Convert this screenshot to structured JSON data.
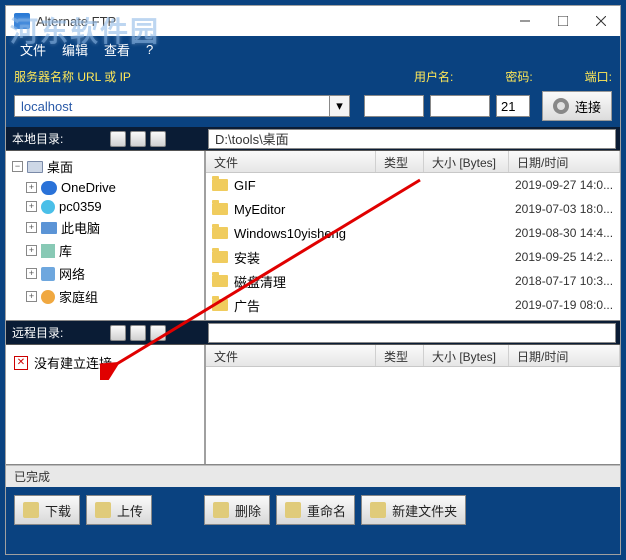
{
  "watermark": "河东软件园",
  "window": {
    "title": "Alternate FTP"
  },
  "menu": {
    "items": [
      "文件",
      "编辑",
      "查看",
      "?"
    ]
  },
  "conn": {
    "server_label": "服务器名称 URL 或 IP",
    "server_value": "localhost",
    "user_label": "用户名:",
    "pass_label": "密码:",
    "port_label": "端口:",
    "port_value": "21",
    "connect_label": "连接"
  },
  "local": {
    "label": "本地目录:",
    "path": "D:\\tools\\桌面",
    "tree": {
      "root": "桌面",
      "items": [
        "OneDrive",
        "pc0359",
        "此电脑",
        "库",
        "网络",
        "家庭组"
      ]
    },
    "headers": [
      "文件",
      "类型",
      "大小 [Bytes]",
      "日期/时间"
    ],
    "rows": [
      {
        "name": "GIF",
        "date": "2019-09-27 14:0..."
      },
      {
        "name": "MyEditor",
        "date": "2019-07-03 18:0..."
      },
      {
        "name": "Windows10yisheng",
        "date": "2019-08-30 14:4..."
      },
      {
        "name": "安装",
        "date": "2019-09-25 14:2..."
      },
      {
        "name": "磁盘清理",
        "date": "2018-07-17 10:3..."
      },
      {
        "name": "广告",
        "date": "2019-07-19 08:0..."
      }
    ]
  },
  "remote": {
    "label": "远程目录:",
    "error": "没有建立连接",
    "headers": [
      "文件",
      "类型",
      "大小 [Bytes]",
      "日期/时间"
    ]
  },
  "status": "已完成",
  "buttons": {
    "download": "下载",
    "upload": "上传",
    "delete": "删除",
    "rename": "重命名",
    "newfolder": "新建文件夹"
  }
}
